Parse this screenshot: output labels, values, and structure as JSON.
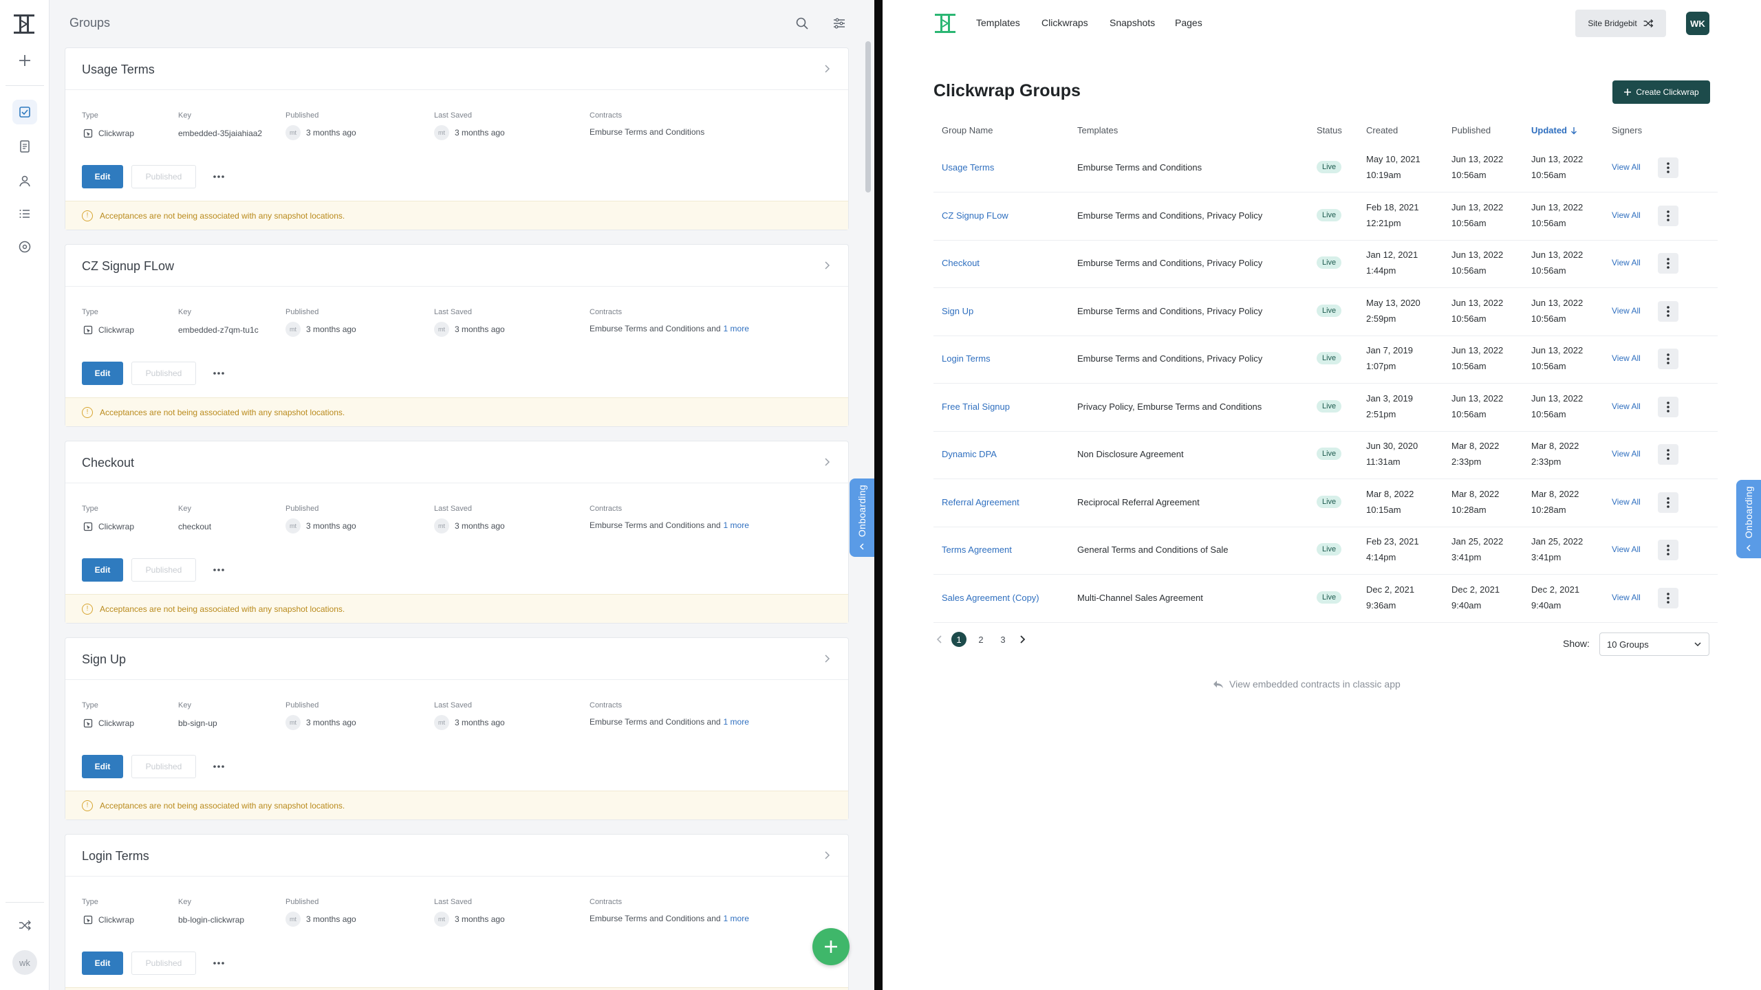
{
  "left": {
    "header_title": "Groups",
    "rail_avatar": "wk",
    "labels": {
      "type": "Type",
      "key": "Key",
      "published": "Published",
      "last_saved": "Last Saved",
      "contracts": "Contracts",
      "edit": "Edit",
      "published_btn": "Published",
      "warning": "Acceptances are not being associated with any snapshot locations."
    },
    "cards": [
      {
        "title": "Usage Terms",
        "type": "Clickwrap",
        "key": "embedded-35jaiahiaa2",
        "av": "mt",
        "published": "3 months ago",
        "saved": "3 months ago",
        "contracts": "Emburse Terms and Conditions",
        "more": ""
      },
      {
        "title": "CZ Signup FLow",
        "type": "Clickwrap",
        "key": "embedded-z7qm-tu1c",
        "av": "mt",
        "published": "3 months ago",
        "saved": "3 months ago",
        "contracts": "Emburse Terms and Conditions and",
        "more": "1 more"
      },
      {
        "title": "Checkout",
        "type": "Clickwrap",
        "key": "checkout",
        "av": "mt",
        "published": "3 months ago",
        "saved": "3 months ago",
        "contracts": "Emburse Terms and Conditions and",
        "more": "1 more"
      },
      {
        "title": "Sign Up",
        "type": "Clickwrap",
        "key": "bb-sign-up",
        "av": "mt",
        "published": "3 months ago",
        "saved": "3 months ago",
        "contracts": "Emburse Terms and Conditions and",
        "more": "1 more"
      },
      {
        "title": "Login Terms",
        "type": "Clickwrap",
        "key": "bb-login-clickwrap",
        "av": "mt",
        "published": "3 months ago",
        "saved": "3 months ago",
        "contracts": "Emburse Terms and Conditions and",
        "more": "1 more"
      }
    ],
    "onboarding": "Onboarding"
  },
  "right": {
    "nav": [
      "Templates",
      "Clickwraps",
      "Snapshots",
      "Pages"
    ],
    "site_button": "Site Bridgebit",
    "user_initials": "WK",
    "page_title": "Clickwrap Groups",
    "create_button": "Create Clickwrap",
    "columns": [
      "Group Name",
      "Templates",
      "Status",
      "Created",
      "Published",
      "Updated",
      "Signers"
    ],
    "rows": [
      {
        "name": "Usage Terms",
        "templates": "Emburse Terms and Conditions",
        "status": "Live",
        "created_d": "May 10, 2021",
        "created_t": "10:19am",
        "pub_d": "Jun 13, 2022",
        "pub_t": "10:56am",
        "upd_d": "Jun 13, 2022",
        "upd_t": "10:56am",
        "signers": "View All"
      },
      {
        "name": "CZ Signup FLow",
        "templates": "Emburse Terms and Conditions, Privacy Policy",
        "status": "Live",
        "created_d": "Feb 18, 2021",
        "created_t": "12:21pm",
        "pub_d": "Jun 13, 2022",
        "pub_t": "10:56am",
        "upd_d": "Jun 13, 2022",
        "upd_t": "10:56am",
        "signers": "View All"
      },
      {
        "name": "Checkout",
        "templates": "Emburse Terms and Conditions, Privacy Policy",
        "status": "Live",
        "created_d": "Jan 12, 2021",
        "created_t": "1:44pm",
        "pub_d": "Jun 13, 2022",
        "pub_t": "10:56am",
        "upd_d": "Jun 13, 2022",
        "upd_t": "10:56am",
        "signers": "View All"
      },
      {
        "name": "Sign Up",
        "templates": "Emburse Terms and Conditions, Privacy Policy",
        "status": "Live",
        "created_d": "May 13, 2020",
        "created_t": "2:59pm",
        "pub_d": "Jun 13, 2022",
        "pub_t": "10:56am",
        "upd_d": "Jun 13, 2022",
        "upd_t": "10:56am",
        "signers": "View All"
      },
      {
        "name": "Login Terms",
        "templates": "Emburse Terms and Conditions, Privacy Policy",
        "status": "Live",
        "created_d": "Jan 7, 2019",
        "created_t": "1:07pm",
        "pub_d": "Jun 13, 2022",
        "pub_t": "10:56am",
        "upd_d": "Jun 13, 2022",
        "upd_t": "10:56am",
        "signers": "View All"
      },
      {
        "name": "Free Trial Signup",
        "templates": "Privacy Policy, Emburse Terms and Conditions",
        "status": "Live",
        "created_d": "Jan 3, 2019",
        "created_t": "2:51pm",
        "pub_d": "Jun 13, 2022",
        "pub_t": "10:56am",
        "upd_d": "Jun 13, 2022",
        "upd_t": "10:56am",
        "signers": "View All"
      },
      {
        "name": "Dynamic DPA",
        "templates": "Non Disclosure Agreement",
        "status": "Live",
        "created_d": "Jun 30, 2020",
        "created_t": "11:31am",
        "pub_d": "Mar 8, 2022",
        "pub_t": "2:33pm",
        "upd_d": "Mar 8, 2022",
        "upd_t": "2:33pm",
        "signers": "View All"
      },
      {
        "name": "Referral Agreement",
        "templates": "Reciprocal Referral Agreement",
        "status": "Live",
        "created_d": "Mar 8, 2022",
        "created_t": "10:15am",
        "pub_d": "Mar 8, 2022",
        "pub_t": "10:28am",
        "upd_d": "Mar 8, 2022",
        "upd_t": "10:28am",
        "signers": "View All"
      },
      {
        "name": "Terms Agreement",
        "templates": "General Terms and Conditions of Sale",
        "status": "Live",
        "created_d": "Feb 23, 2021",
        "created_t": "4:14pm",
        "pub_d": "Jan 25, 2022",
        "pub_t": "3:41pm",
        "upd_d": "Jan 25, 2022",
        "upd_t": "3:41pm",
        "signers": "View All"
      },
      {
        "name": "Sales Agreement (Copy)",
        "templates": "Multi-Channel Sales Agreement",
        "status": "Live",
        "created_d": "Dec 2, 2021",
        "created_t": "9:36am",
        "pub_d": "Dec 2, 2021",
        "pub_t": "9:40am",
        "upd_d": "Dec 2, 2021",
        "upd_t": "9:40am",
        "signers": "View All"
      }
    ],
    "pages": [
      "1",
      "2",
      "3"
    ],
    "current_page": "1",
    "show_label": "Show:",
    "show_value": "10 Groups",
    "classic_link": "View embedded contracts in classic app",
    "onboarding": "Onboarding"
  },
  "colors": {
    "primary_dark": "#1d4b4b",
    "link": "#2f6fbf",
    "edit_btn": "#2f7bbf",
    "live_badge": "#d8f0ea",
    "fab": "#3fb76a",
    "onboarding_tab": "#5a9be6",
    "logo_green": "#2bb673"
  },
  "icons": [
    "logo-icon",
    "plus-icon",
    "clickwrap-icon",
    "document-icon",
    "user-icon",
    "list-icon",
    "settings-icon",
    "shuffle-icon",
    "search-icon",
    "filter-icon",
    "chevron-right-icon",
    "info-icon",
    "ellipsis-icon",
    "kebab-icon",
    "sort-down-icon",
    "chevron-down-icon",
    "back-arrow-icon"
  ]
}
